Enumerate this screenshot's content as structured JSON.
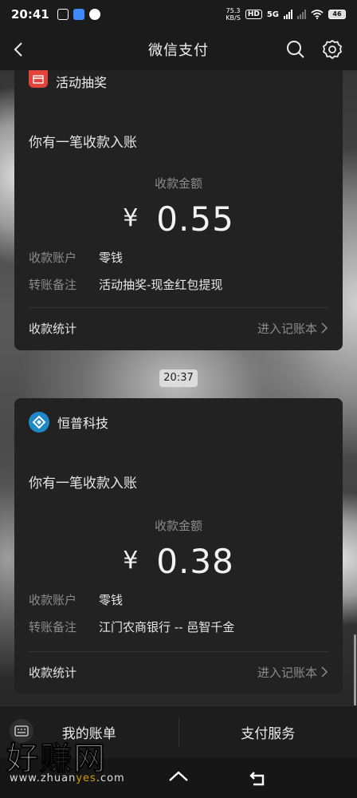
{
  "status_bar": {
    "time": "20:41",
    "net_speed_value": "75.3",
    "net_speed_unit": "KB/S",
    "hd_label": "HD",
    "network": "5G",
    "battery": "46"
  },
  "header": {
    "title": "微信支付"
  },
  "cards": [
    {
      "brand": "活动抽奖",
      "message_title": "你有一笔收款入账",
      "amount_label": "收款金额",
      "currency": "¥",
      "amount": "0.55",
      "rows": [
        {
          "key": "收款账户",
          "value": "零钱"
        },
        {
          "key": "转账备注",
          "value": "活动抽奖-现金红包提现"
        }
      ],
      "footer_left": "收款统计",
      "footer_right": "进入记账本"
    },
    {
      "brand": "恒普科技",
      "message_title": "你有一笔收款入账",
      "amount_label": "收款金额",
      "currency": "¥",
      "amount": "0.38",
      "rows": [
        {
          "key": "收款账户",
          "value": "零钱"
        },
        {
          "key": "转账备注",
          "value": "江门农商银行 -- 邑智千金"
        }
      ],
      "footer_left": "收款统计",
      "footer_right": "进入记账本"
    }
  ],
  "timestamp_chip": "20:37",
  "bottom_menu": {
    "left": "我的账单",
    "right": "支付服务"
  },
  "watermark": {
    "big": "好赚网",
    "small_prefix": "www.zhuan",
    "small_accent": "yes",
    "small_suffix": ".com"
  },
  "colors": {
    "card_bg": "#222222",
    "activity_brand": "#e0443a",
    "hengpu_brand": "#1e88c8"
  }
}
